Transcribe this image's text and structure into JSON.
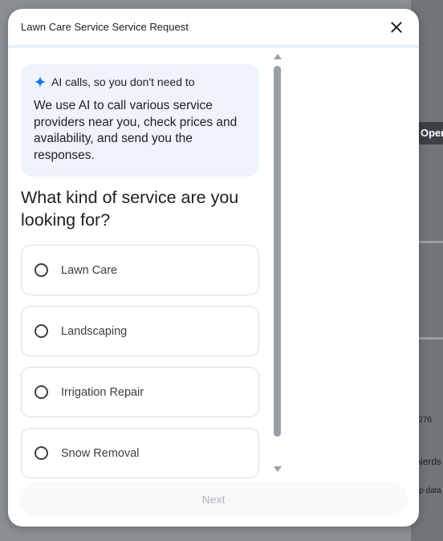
{
  "dialog": {
    "title": "Lawn Care Service Service Request"
  },
  "info": {
    "heading": "AI calls, so you don't need to",
    "body": "We use AI to call various service providers near you, check prices and availability, and send you the responses."
  },
  "question": "What kind of service are you looking for?",
  "options": [
    {
      "label": "Lawn Care"
    },
    {
      "label": "Landscaping"
    },
    {
      "label": "Irrigation Repair"
    },
    {
      "label": "Snow Removal"
    }
  ],
  "footer": {
    "next_label": "Next"
  },
  "background": {
    "open_chip": "Oper",
    "nerds_label": "Nerds",
    "map_data": "p data",
    "route": "276"
  },
  "colors": {
    "accent": "#1a73e8",
    "info_card": "#eef3fc"
  }
}
